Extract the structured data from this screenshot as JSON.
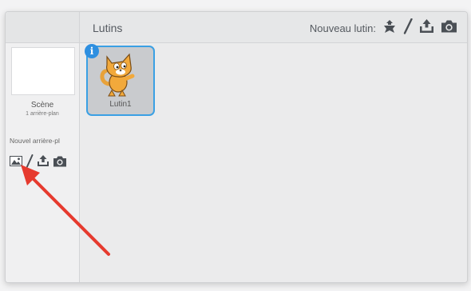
{
  "stage": {
    "name": "Scène",
    "backdrop_count": "1 arrière-plan",
    "new_backdrop_label": "Nouvel arrière-pl"
  },
  "backdrop_tools": [
    {
      "icon": "image-library-icon"
    },
    {
      "icon": "paint-brush-icon"
    },
    {
      "icon": "upload-icon"
    },
    {
      "icon": "camera-icon"
    }
  ],
  "sprites": {
    "title": "Lutins",
    "new_sprite_label": "Nouveau lutin:",
    "tools": [
      {
        "icon": "sprite-library-icon"
      },
      {
        "icon": "paint-brush-icon"
      },
      {
        "icon": "upload-icon"
      },
      {
        "icon": "camera-icon"
      }
    ],
    "items": [
      {
        "name": "Lutin1",
        "selected": true,
        "info_badge": "i"
      }
    ]
  },
  "colors": {
    "selection": "#3aa0e4",
    "arrow": "#e63a2e",
    "badge": "#2e8fe0"
  }
}
